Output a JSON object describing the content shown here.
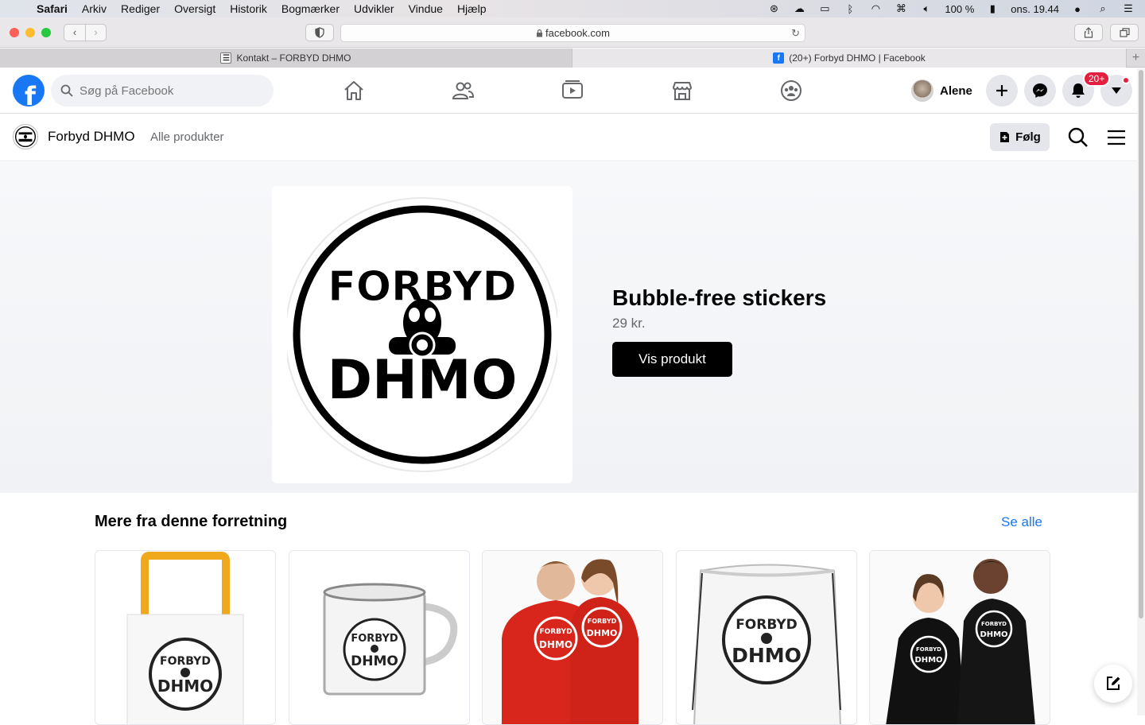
{
  "menubar": {
    "app_name": "Safari",
    "items": [
      "Arkiv",
      "Rediger",
      "Oversigt",
      "Historik",
      "Bogmærker",
      "Udvikler",
      "Vindue",
      "Hjælp"
    ],
    "battery": "100 %",
    "clock": "ons. 19.44"
  },
  "browser": {
    "url": "facebook.com",
    "tabs": [
      {
        "label": "Kontakt – FORBYD DHMO"
      },
      {
        "label": "(20+) Forbyd DHMO | Facebook"
      }
    ]
  },
  "facebook": {
    "search_placeholder": "Søg på Facebook",
    "profile_name": "Alene",
    "notification_badge": "20+"
  },
  "shop": {
    "name": "Forbyd DHMO",
    "nav_link": "Alle produkter",
    "follow_label": "Følg"
  },
  "hero": {
    "logo_line1": "FORBYD",
    "logo_line2": "DHMO",
    "title": "Bubble-free stickers",
    "price": "29 kr.",
    "button": "Vis produkt"
  },
  "more": {
    "title": "Mere fra denne forretning",
    "see_all": "Se alle",
    "products": [
      {
        "kind": "tote-bag",
        "logo": "FORBYD DHMO"
      },
      {
        "kind": "enamel-mug",
        "logo": "FORBYD DHMO"
      },
      {
        "kind": "red-hoodies",
        "logo": "FORBYD DHMO"
      },
      {
        "kind": "drawstring-bag",
        "logo": "FORBYD DHMO"
      },
      {
        "kind": "black-tshirts",
        "logo": "FORBYD DHMO"
      }
    ]
  },
  "colors": {
    "fb_blue": "#1877f2",
    "badge_red": "#e41e3f",
    "hoodie_red": "#d9261c",
    "tote_handle": "#f0a81c"
  }
}
